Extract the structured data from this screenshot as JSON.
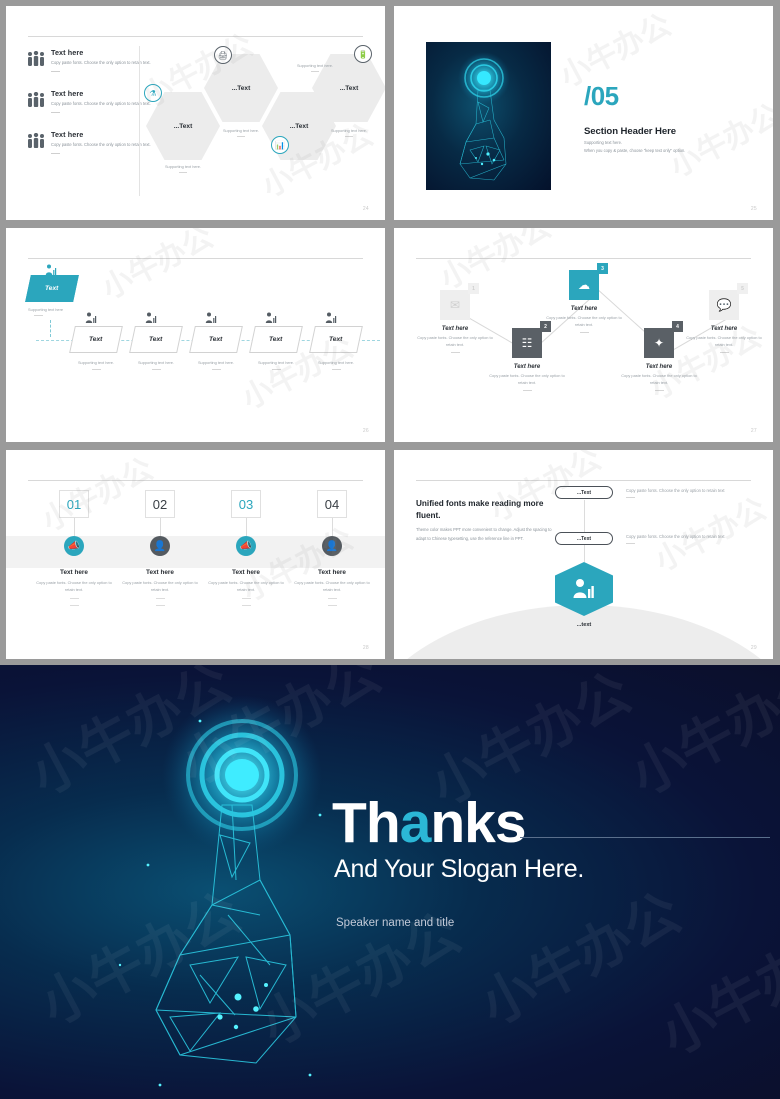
{
  "theme": {
    "accent": "#2ba6bd",
    "dark": "#5a6066",
    "pale": "#ececec",
    "text": "#2a2f35",
    "muted": "#9aa1a7"
  },
  "watermark": "小牛办公",
  "slide1": {
    "page_number": "24",
    "left_items": [
      {
        "title": "Text here",
        "body": "Copy paste fonts. Choose the only option to retain text."
      },
      {
        "title": "Text here",
        "body": "Copy paste fonts. Choose the only option to retain text."
      },
      {
        "title": "Text here",
        "body": "Copy paste fonts. Choose the only option to retain text."
      }
    ],
    "hexagons": [
      {
        "label": "...Text",
        "support": "Supporting text here.",
        "icon": "flask-icon",
        "icon_style": "teal"
      },
      {
        "label": "...Text",
        "support": "Supporting text here.",
        "icon": "print-icon",
        "icon_style": "dark"
      },
      {
        "label": "...Text",
        "support": "Supporting text here.",
        "icon": "chart-icon",
        "icon_style": "teal"
      },
      {
        "label": "...Text",
        "support": "Supporting text here.",
        "icon": "battery-icon",
        "icon_style": "dark"
      }
    ]
  },
  "slide2": {
    "page_number": "25",
    "number": "/05",
    "header": "Section Header Here",
    "support_line1": "Supporting text here.",
    "support_line2": "When you copy & paste, choose \"keep text only\" option."
  },
  "slide3": {
    "page_number": "26",
    "lead": {
      "label": "Text",
      "support": "Supporting text here"
    },
    "steps": [
      {
        "label": "Text",
        "support": "Supporting text here."
      },
      {
        "label": "Text",
        "support": "Supporting text here."
      },
      {
        "label": "Text",
        "support": "Supporting text here."
      },
      {
        "label": "Text",
        "support": "Supporting text here."
      },
      {
        "label": "Text",
        "support": "Supporting text here."
      }
    ]
  },
  "slide4": {
    "page_number": "27",
    "nodes": [
      {
        "num": "1",
        "title": "Text here",
        "body": "Copy paste fonts. Choose the only option to retain text.",
        "style": "pale",
        "icon": "mail-icon"
      },
      {
        "num": "2",
        "title": "Text here",
        "body": "Copy paste fonts. Choose the only option to retain text.",
        "style": "dark",
        "icon": "network-icon"
      },
      {
        "num": "3",
        "title": "Text here",
        "body": "Copy paste fonts. Choose the only option to retain text.",
        "style": "teal",
        "icon": "cloud-icon"
      },
      {
        "num": "4",
        "title": "Text here",
        "body": "Copy paste fonts. Choose the only option to retain text.",
        "style": "dark",
        "icon": "gear-icon"
      },
      {
        "num": "5",
        "title": "Text here",
        "body": "Copy paste fonts. Choose the only option to retain text.",
        "style": "pale",
        "icon": "chat-icon"
      }
    ]
  },
  "slide5": {
    "page_number": "28",
    "columns": [
      {
        "num": "01",
        "title": "Text here",
        "body": "Copy paste fonts. Choose the only option to retain text.",
        "style": "teal",
        "icon": "speaker-icon"
      },
      {
        "num": "02",
        "title": "Text here",
        "body": "Copy paste fonts. Choose the only option to retain text.",
        "style": "dark",
        "icon": "person-icon"
      },
      {
        "num": "03",
        "title": "Text here",
        "body": "Copy paste fonts. Choose the only option to retain text.",
        "style": "teal",
        "icon": "speaker-icon"
      },
      {
        "num": "04",
        "title": "Text here",
        "body": "Copy paste fonts. Choose the only option to retain text.",
        "style": "dark",
        "icon": "person-icon"
      }
    ]
  },
  "slide6": {
    "page_number": "29",
    "heading": "Unified fonts make reading more fluent.",
    "body": "Theme color makes PPT more convenient to change. Adjust the spacing to adapt to Chinese typesetting, use the reference line in PPT.",
    "rows": [
      {
        "pill": "...Text",
        "desc": "Copy paste fonts. Choose the only option to retain text"
      },
      {
        "pill": "...Text",
        "desc": "Copy paste fonts. Choose the only option to retain text"
      }
    ],
    "hex_label": "...text",
    "hex_icon": "user-chart-icon"
  },
  "thanks": {
    "title_part1": "Th",
    "title_accent": "a",
    "title_part2": "nks",
    "slogan": "And Your Slogan Here.",
    "speaker": "Speaker name and title"
  }
}
